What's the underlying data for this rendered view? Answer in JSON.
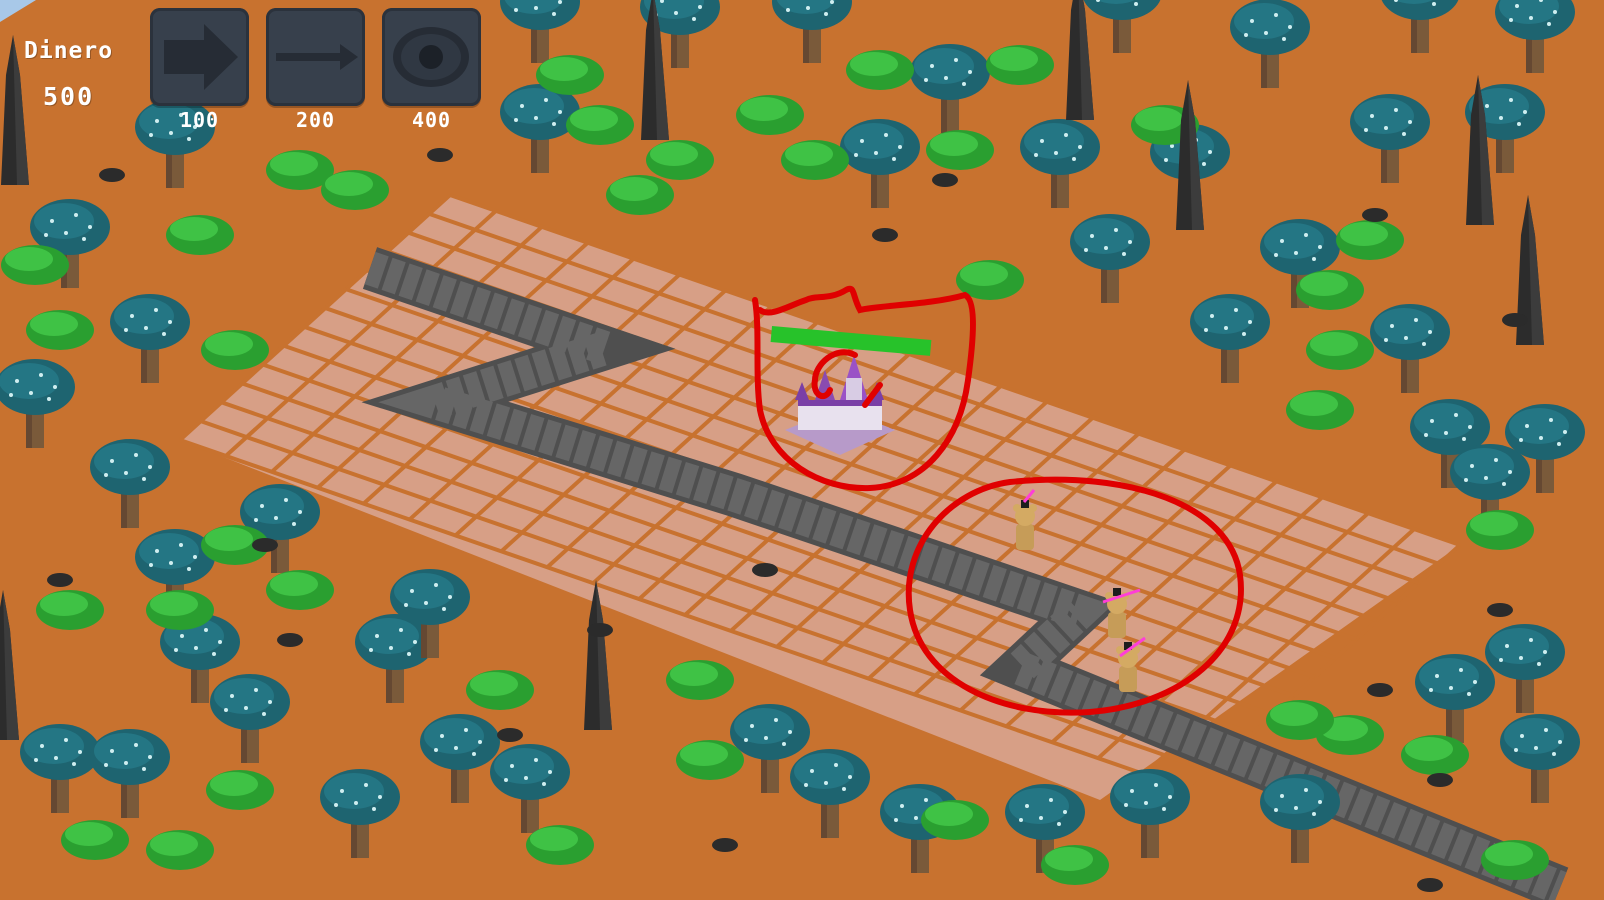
{
  "hud": {
    "money_label": "Dinero",
    "money_value": "500",
    "towers": [
      {
        "icon": "arrow-tower-icon",
        "cost": "100"
      },
      {
        "icon": "lance-tower-icon",
        "cost": "200"
      },
      {
        "icon": "eye-tower-icon",
        "cost": "400"
      }
    ]
  },
  "colors": {
    "ground": "#c8722f",
    "tile": "#dba18a",
    "path": "#5a5a5a",
    "tree_canopy": "#1e6470",
    "tree_trunk": "#7a5a3a",
    "bush": "#2fae35",
    "rock_spire": "#2e2e2e",
    "castle": "#8a4bb0",
    "health_bar": "#27c22a",
    "annotation": "#e00000",
    "button": "#37404c",
    "hud_text": "#ffffff"
  }
}
